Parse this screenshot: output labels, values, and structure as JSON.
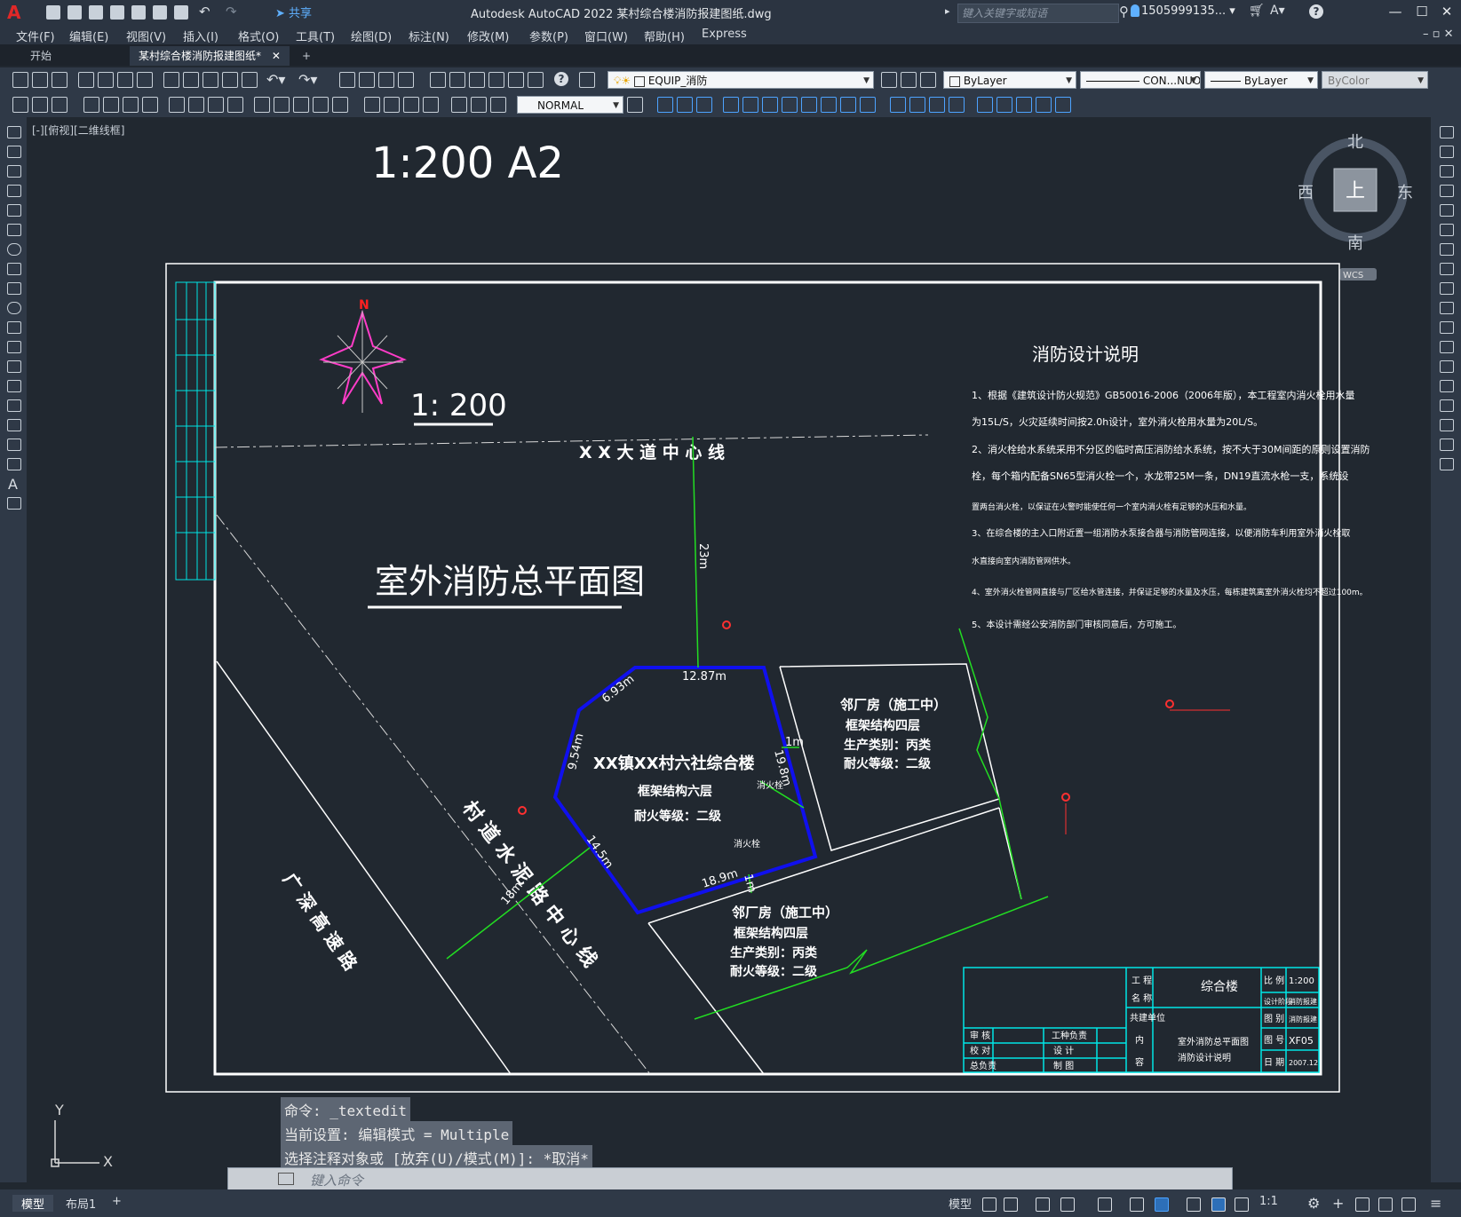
{
  "window": {
    "title": "Autodesk AutoCAD 2022    某村综合楼消防报建图纸.dwg",
    "share_label": "共享",
    "search_placeholder": "键入关键字或短语",
    "user": "1505999135... ▾"
  },
  "menu": [
    "文件(F)",
    "编辑(E)",
    "视图(V)",
    "插入(I)",
    "格式(O)",
    "工具(T)",
    "绘图(D)",
    "标注(N)",
    "修改(M)",
    "参数(P)",
    "窗口(W)",
    "帮助(H)",
    "Express"
  ],
  "tabs": {
    "start": "开始",
    "active": "某村综合楼消防报建图纸*",
    "add": "+"
  },
  "toolbar": {
    "layer": "EQUIP_消防",
    "color": "ByLayer",
    "linetype": "CON...NUOU",
    "lineweight": "ByLayer",
    "plotstyle": "ByColor",
    "textstyle": "NORMAL"
  },
  "viewport_label": "[-][俯视][二维线框]",
  "viewcube": {
    "north": "北",
    "south": "南",
    "east": "东",
    "west": "西",
    "top": "上",
    "wcs": "WCS"
  },
  "drawing": {
    "scale_header": "1:200 A2",
    "north_label": "N",
    "scale_text": "1: 200",
    "road_centerline": "X  X  大  道  中  心  线",
    "main_title": "室外消防总平面图",
    "village_road": "村 道 水 泥 路 中 心 线",
    "highway": "广 深 高 速 路",
    "building_name": "XX镇XX村六社综合楼",
    "building_struct": "框架结构六层",
    "building_fire": "耐火等级：二级",
    "neighbor1": [
      "邻厂房（施工中）",
      "框架结构四层",
      "生产类别：丙类",
      "耐火等级：二级"
    ],
    "neighbor2": [
      "邻厂房（施工中）",
      "框架结构四层",
      "生产类别：丙类",
      "耐火等级：二级"
    ],
    "dims": {
      "d23": "23m",
      "d1287": "12.87m",
      "d693": "6.93m",
      "d954": "9.54m",
      "d198": "19.8m",
      "d1m_a": "1m",
      "d145": "14.5m",
      "d189": "18.9m",
      "d1m_b": "1m",
      "d18": "18m"
    },
    "hydrant_label": "消火栓",
    "notes_title": "消防设计说明",
    "notes": [
      "1、根据《建筑设计防火规范》GB50016-2006（2006年版），本工程室内消火栓用水量",
      "为15L/S，火灾延续时间按2.0h设计，室外消火栓用水量为20L/S。",
      "2、消火栓给水系统采用不分区的临时高压消防给水系统，按不大于30M间距的原则设置消防",
      "栓，每个箱内配备SN65型消火栓一个，水龙带25M一条，DN19直流水枪一支，系统设",
      "置两台消火栓，以保证在火警时能使任何一个室内消火栓有足够的水压和水量。",
      "3、在综合楼的主入口附近置一组消防水泵接合器与消防管网连接，以便消防车利用室外消火栓取",
      "水直接向室内消防管网供水。",
      "4、室外消火栓管网直接与厂区给水管连接，并保证足够的水量及水压，每栋建筑离室外消火栓均不超过100m。",
      "5、本设计需经公安消防部门审核同意后，方可施工。"
    ],
    "titleblock": {
      "proj_label1": "工 程",
      "proj_label2": "名 称",
      "proj_name": "综合楼",
      "ratio_label": "比 例",
      "ratio": "1:200",
      "builder_label": "共建单位",
      "row_a": [
        "设计阶段",
        "消防报建"
      ],
      "tuhao_label": "图 别",
      "tubie": "消防报建",
      "sheet_label": "图 号",
      "sheet": "XF05",
      "date_label": "日 期",
      "date": "2007.12",
      "content_label1": "内",
      "content_label2": "容",
      "content1": "室外消防总平面图",
      "content2": "消防设计说明",
      "staff": [
        "审 核",
        "校 对",
        "总负责",
        "工种负责",
        "设 计",
        "制 图"
      ]
    }
  },
  "command_history": [
    "命令: _textedit",
    "当前设置: 编辑模式 = Multiple",
    "选择注释对象或 [放弃(U)/模式(M)]: *取消*"
  ],
  "command_placeholder": "键入命令",
  "statusbar": {
    "model_tab": "模型",
    "layout_tab": "布局1",
    "add": "+",
    "model_btn": "模型",
    "scale": "1:1"
  },
  "ucs": {
    "x": "X",
    "y": "Y"
  }
}
